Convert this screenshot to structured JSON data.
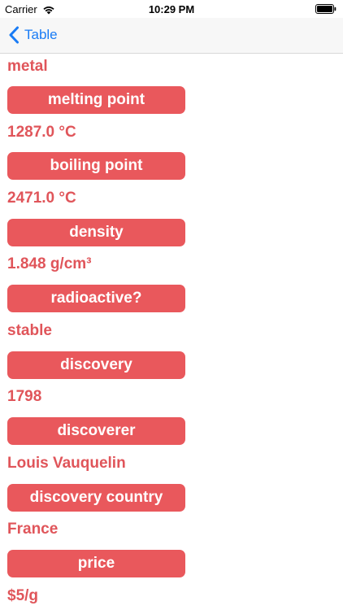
{
  "status_bar": {
    "carrier": "Carrier",
    "time": "10:29 PM"
  },
  "nav": {
    "back_label": "Table"
  },
  "element": {
    "category": "metal",
    "properties": [
      {
        "label": "melting point",
        "value": "1287.0 °C"
      },
      {
        "label": "boiling point",
        "value": "2471.0 °C"
      },
      {
        "label": "density",
        "value": "1.848 g/cm³"
      },
      {
        "label": "radioactive?",
        "value": "stable"
      },
      {
        "label": "discovery",
        "value": "1798"
      },
      {
        "label": "discoverer",
        "value": "Louis Vauquelin"
      },
      {
        "label": "discovery country",
        "value": "France"
      },
      {
        "label": "price",
        "value": "$5/g"
      }
    ]
  },
  "colors": {
    "accent": "#e9585c",
    "value_text": "#e0555a",
    "link": "#1a7cf5"
  }
}
